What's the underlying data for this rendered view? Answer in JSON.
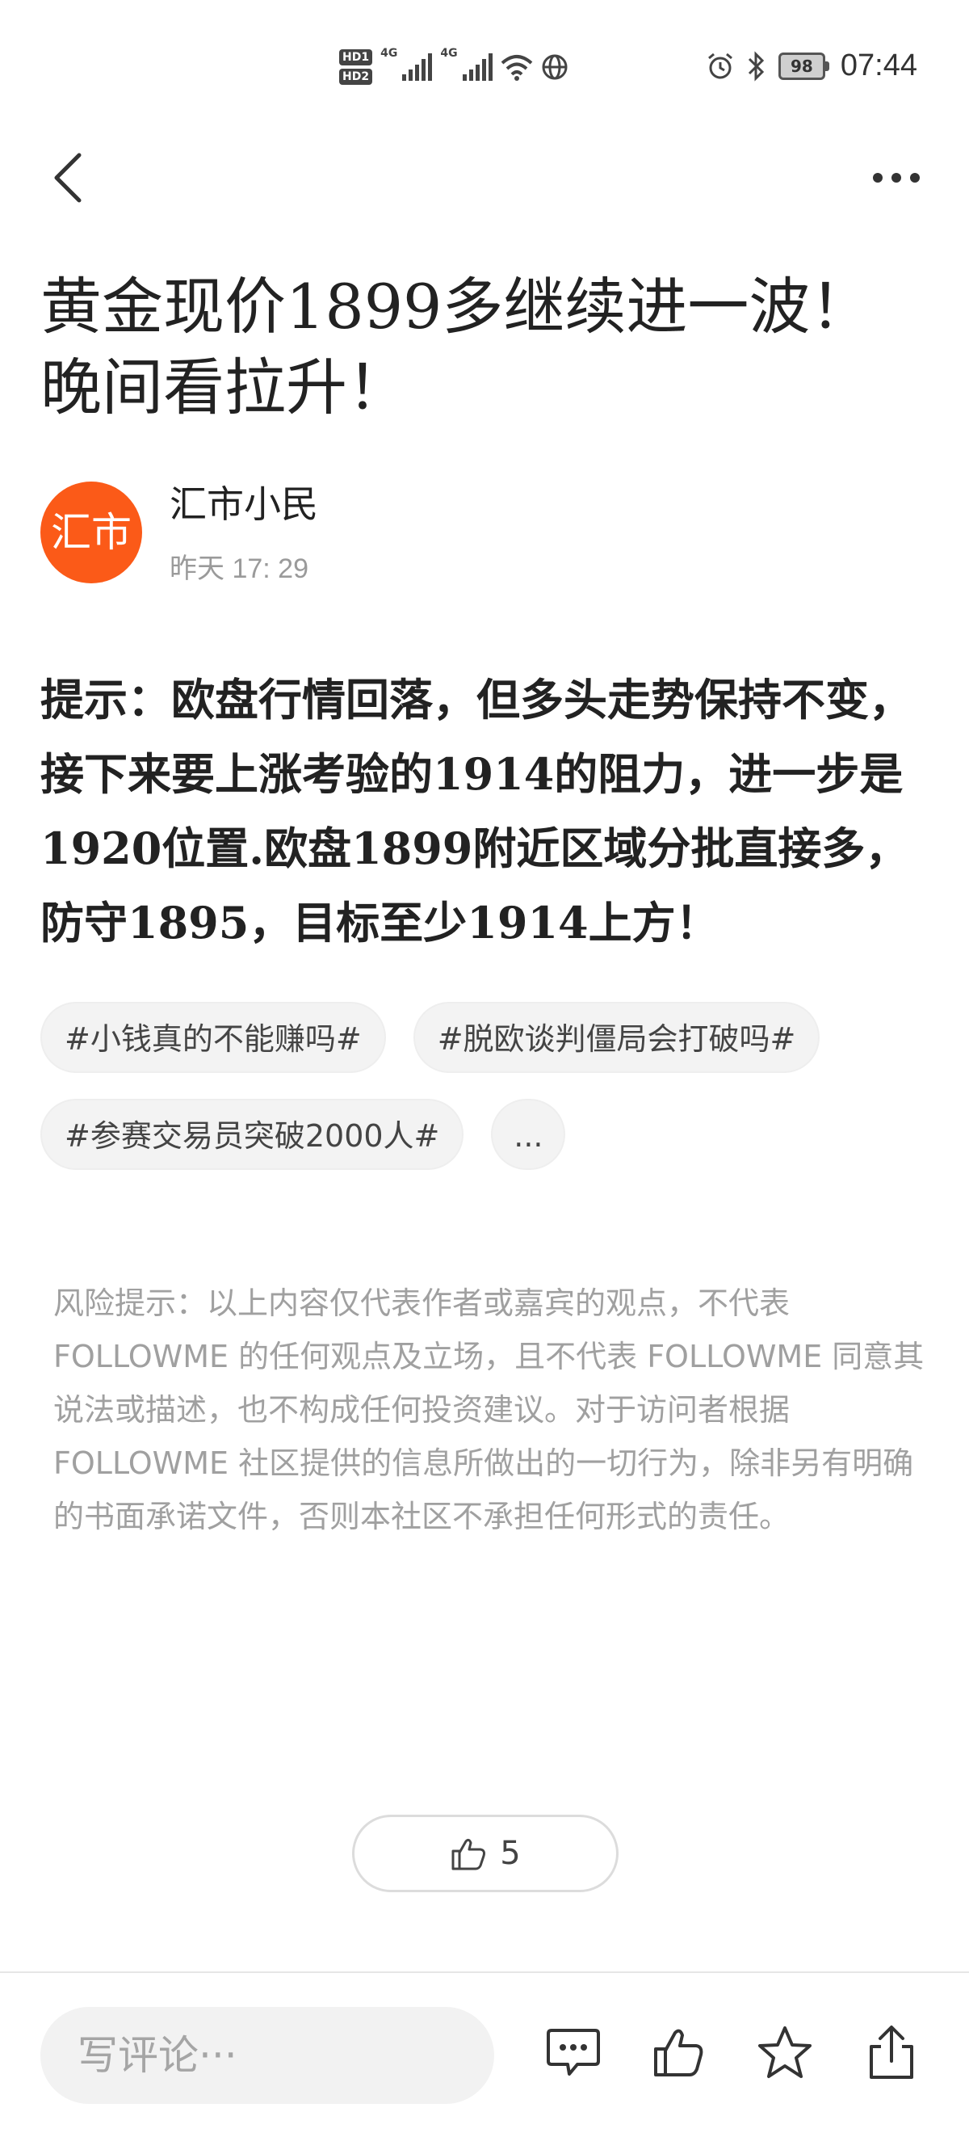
{
  "status_bar": {
    "hd1": "HD1",
    "hd2": "HD2",
    "net1": "4G",
    "net2": "4G",
    "battery": "98",
    "time": "07:44"
  },
  "nav": {
    "back_icon": "chevron-left-icon",
    "more_icon": "more-horizontal-icon"
  },
  "post": {
    "title": "黄金现价1899多继续进一波！晚间看拉升！",
    "author": {
      "avatar_text": "汇市",
      "avatar_color": "#fb5a18",
      "name": "汇市小民",
      "time": "昨天 17: 29"
    },
    "body": "提示：欧盘行情回落，但多头走势保持不变，接下来要上涨考验的1914的阻力，进一步是1920位置.欧盘1899附近区域分批直接多，防守1895，目标至少1914上方！",
    "tags": [
      "#小钱真的不能赚吗#",
      "#脱欧谈判僵局会打破吗#",
      "#参赛交易员突破2000人#"
    ],
    "tags_more": "...",
    "disclaimer": "风险提示：以上内容仅代表作者或嘉宾的观点，不代表 FOLLOWME 的任何观点及立场，且不代表 FOLLOWME 同意其说法或描述，也不构成任何投资建议。对于访问者根据 FOLLOWME 社区提供的信息所做出的一切行为，除非另有明确的书面承诺文件，否则本社区不承担任何形式的责任。",
    "likes": "5"
  },
  "bottom_bar": {
    "comment_placeholder": "写评论···",
    "icons": [
      "comment-icon",
      "thumbs-up-icon",
      "star-icon",
      "share-icon"
    ]
  }
}
